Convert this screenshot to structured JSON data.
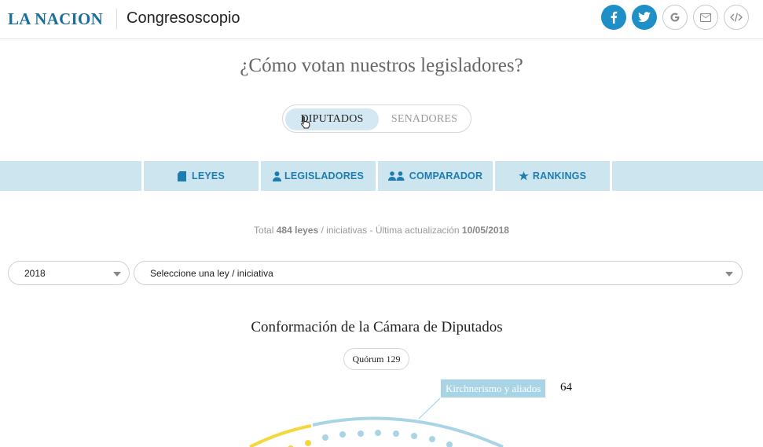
{
  "header": {
    "brand": "LA NACION",
    "app_name": "Congresoscopio",
    "share_icons": [
      "facebook-icon",
      "twitter-icon",
      "google-icon",
      "mail-icon",
      "embed-icon"
    ],
    "accent_color": "#1e8fc7"
  },
  "question": "¿Cómo votan nuestros legisladores?",
  "chamber_toggle": {
    "options": [
      "DIPUTADOS",
      "SENADORES"
    ],
    "selected": "DIPUTADOS"
  },
  "nav": {
    "items": [
      {
        "label": "LEYES",
        "icon": "document-icon"
      },
      {
        "label": "LEGISLADORES",
        "icon": "person-icon"
      },
      {
        "label": "COMPARADOR",
        "icon": "people-icon"
      },
      {
        "label": "RANKINGS",
        "icon": "star-icon"
      }
    ]
  },
  "totals": {
    "prefix": "Total",
    "count": "484 leyes",
    "middle": "/ iniciativas - Última actualización",
    "date": "10/05/2018"
  },
  "filters": {
    "year": "2018",
    "law": "Seleccione una ley / iniciativa"
  },
  "chamber": {
    "title": "Conformación de la Cámara de Diputados",
    "quorum": "Quórum 129",
    "highlight_party": "Kirchnerismo y aliados",
    "highlight_count": "64",
    "colors": {
      "kirchnerismo": "#a9d4e6",
      "cambiemos": "#f5d73c"
    }
  }
}
